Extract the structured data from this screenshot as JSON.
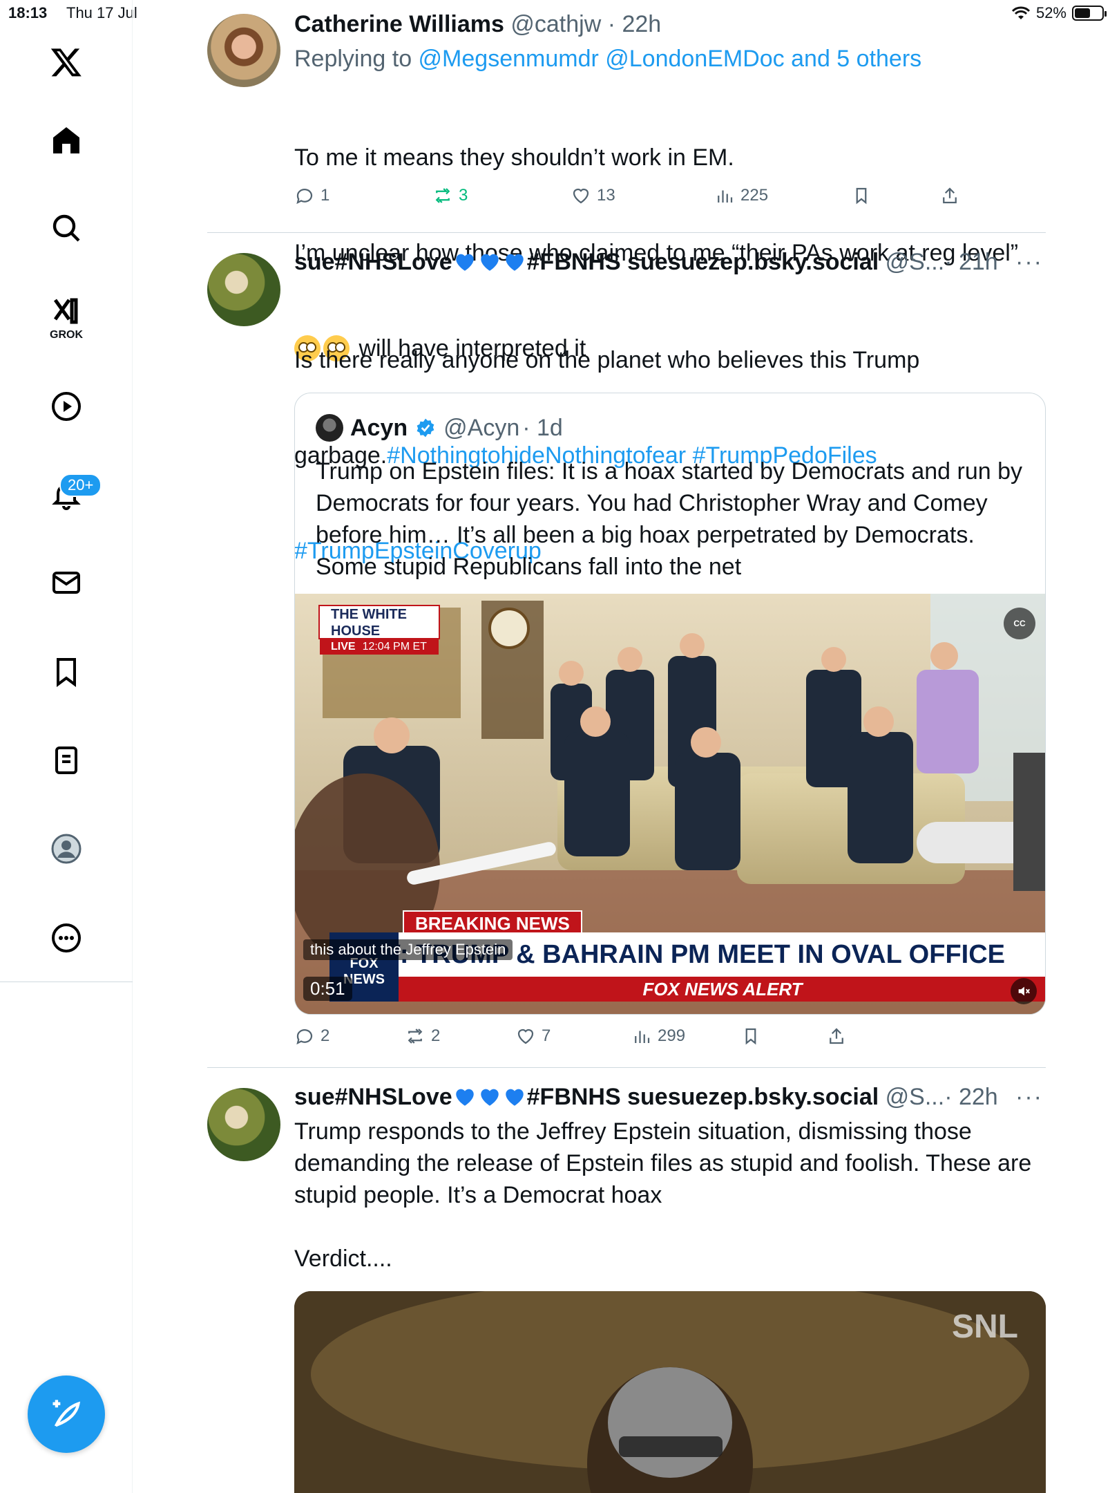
{
  "status": {
    "time": "18:13",
    "date": "Thu 17 Jul",
    "battery": "52%"
  },
  "sidebar": {
    "grok_label": "GROK",
    "notification_badge": "20+"
  },
  "tweets": [
    {
      "name": "Catherine Williams",
      "handle": "@cathjw",
      "time": "· 22h",
      "reply_prefix": "Replying to ",
      "reply_to": "@Megsenmumdr @LondonEMDoc and 5 others",
      "line1": "To me it means they shouldn’t work in EM.",
      "line2": "I’m unclear how those who claimed to me “their PAs work at reg level”",
      "line3": " will have interpreted it",
      "replies": "1",
      "reposts": "3",
      "likes": "13",
      "views": "225"
    },
    {
      "name": "sue#NHSLove",
      "name_suffix": "#FBNHS suesuezep.bsky.social",
      "handle": "@S...",
      "time": "· 21h",
      "more": "···",
      "text_a": "Is there really anyone on the planet who believes this Trump",
      "text_b": "garbage.",
      "tag1": "#NothingtohideNothingtofear",
      "tag2": "#TrumpPedoFiles",
      "tag3": "#TrumpEpsteinCoverup",
      "replies": "2",
      "reposts": "2",
      "likes": "7",
      "views": "299",
      "quote": {
        "name": "Acyn",
        "handle": "@Acyn",
        "time": "· 1d",
        "text": "Trump on Epstein files: It is a hoax started by Democrats and run by Democrats for four years. You had Christopher Wray and Comey before him… It’s all been a big hoax perpetrated by Democrats. Some stupid Republicans fall into the net",
        "video": {
          "live_title": "THE WHITE HOUSE",
          "live_label": "LIVE",
          "live_time": "12:04 PM ET",
          "breaking": "BREAKING NEWS",
          "headline": "NOW: TRUMP & BAHRAIN PM MEET IN OVAL OFFICE",
          "alert": "FOX NEWS ALERT",
          "channel": "FOX NEWS",
          "caption": "this about the Jeffrey Epstein",
          "duration": "0:51",
          "cc": "CC"
        }
      }
    },
    {
      "name": "sue#NHSLove",
      "name_suffix": "#FBNHS suesuezep.bsky.social",
      "handle": "@S...",
      "time": "· 22h",
      "more": "···",
      "text": "Trump responds to the Jeffrey Epstein situation, dismissing those demanding the release of Epstein files as stupid and foolish. These are stupid people. It’s a Democrat hoax\n\nVerdict....",
      "media_badge": "SNL"
    }
  ],
  "colors": {
    "accent": "#1d9bf0",
    "repost_active": "#00ba7c",
    "muted": "#536471"
  }
}
